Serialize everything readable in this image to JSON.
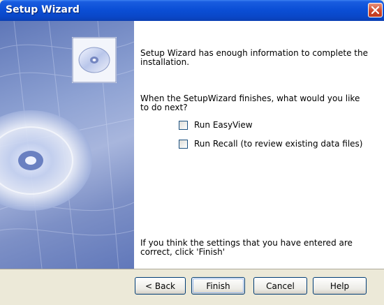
{
  "window": {
    "title": "Setup Wizard"
  },
  "content": {
    "message": "Setup Wizard has enough information to complete the installation.",
    "question": "When the SetupWizard finishes, what would you like to do next?",
    "options": [
      {
        "label": "Run EasyView",
        "checked": false
      },
      {
        "label": "Run Recall (to review existing data files)",
        "checked": false
      }
    ],
    "finish_note": "If you think the settings that you have entered are correct, click 'Finish'"
  },
  "buttons": {
    "back": "< Back",
    "finish": "Finish",
    "cancel": "Cancel",
    "help": "Help"
  },
  "colors": {
    "titlebar": "#0b4fd6",
    "dialog_background": "#ece9d8",
    "close_button": "#d0482a"
  }
}
